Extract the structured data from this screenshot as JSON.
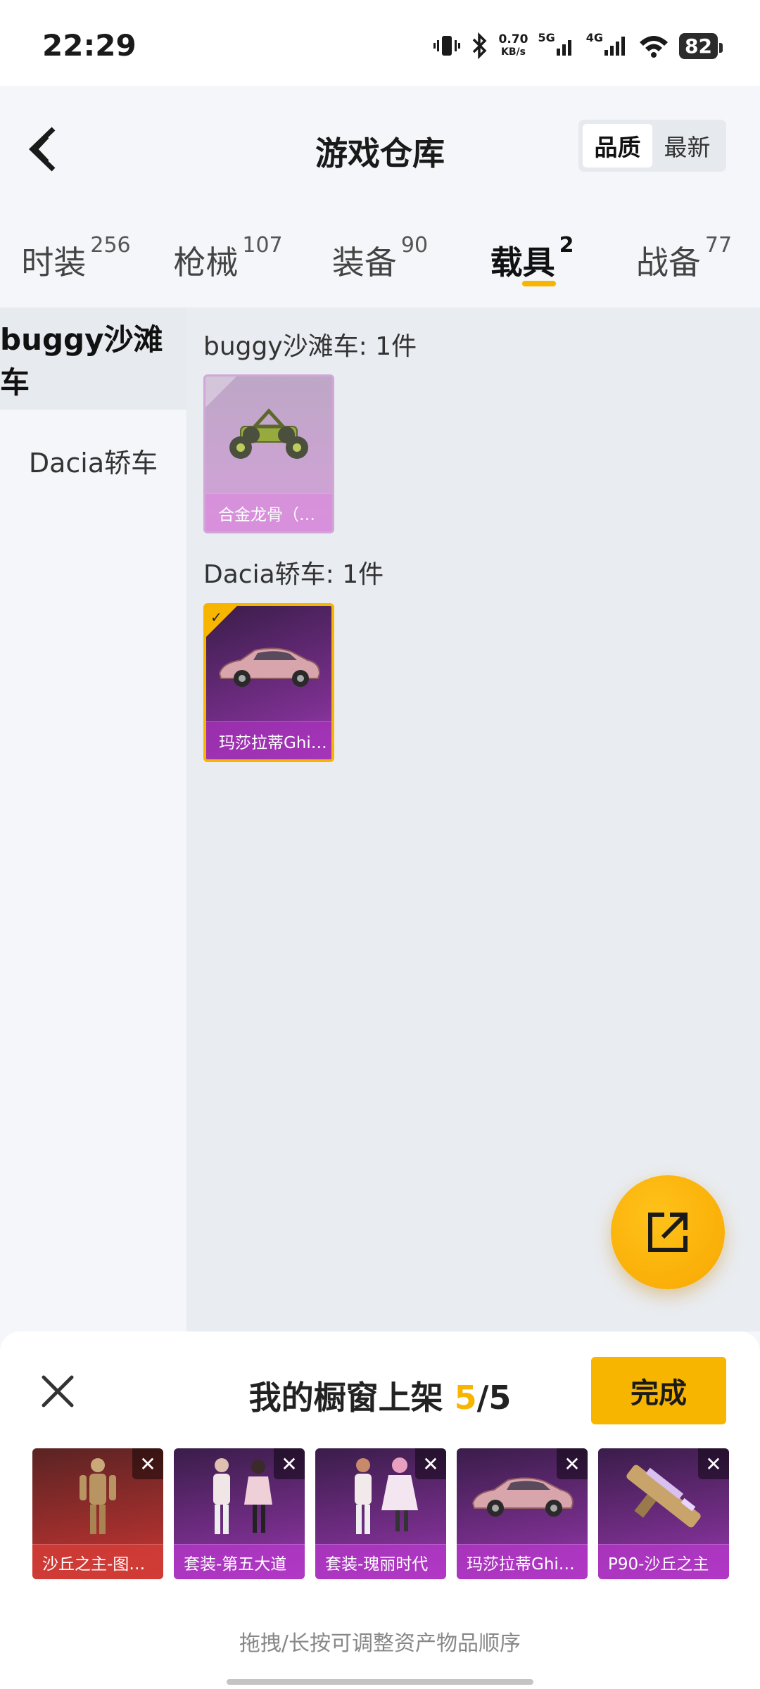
{
  "status_bar": {
    "time": "22:29",
    "speed_value": "0.70",
    "speed_unit": "KB/s",
    "net1": "5G",
    "net2": "4G",
    "battery": "82"
  },
  "header": {
    "title": "游戏仓库",
    "sort_options": [
      "品质",
      "最新"
    ],
    "sort_active": "品质"
  },
  "tabs": [
    {
      "label": "时装",
      "count": "256"
    },
    {
      "label": "枪械",
      "count": "107"
    },
    {
      "label": "装备",
      "count": "90"
    },
    {
      "label": "载具",
      "count": "2"
    },
    {
      "label": "战备",
      "count": "77"
    }
  ],
  "active_tab": "载具",
  "sidebar": {
    "items": [
      {
        "label": "buggy沙滩车"
      },
      {
        "label": "Dacia轿车"
      }
    ]
  },
  "groups": [
    {
      "title": "buggy沙滩车: 1件",
      "items": [
        {
          "name": "合金龙骨（…",
          "selected": false
        }
      ]
    },
    {
      "title": "Dacia轿车: 1件",
      "items": [
        {
          "name": "玛莎拉蒂Ghi…",
          "selected": true
        }
      ]
    }
  ],
  "fab": {
    "icon": "share-icon"
  },
  "showcase": {
    "title_prefix": "我的橱窗上架",
    "count_now": "5",
    "count_sep": "/",
    "count_max": "5",
    "done_label": "完成",
    "items": [
      {
        "name": "沙丘之主-图…",
        "color": "#c9302c"
      },
      {
        "name": "套装-第五大道",
        "color": "#a43dbd"
      },
      {
        "name": "套装-瑰丽时代",
        "color": "#a43dbd"
      },
      {
        "name": "玛莎拉蒂Ghi…",
        "color": "#a43dbd"
      },
      {
        "name": "P90-沙丘之主",
        "color": "#a43dbd"
      }
    ],
    "hint": "拖拽/长按可调整资产物品顺序"
  },
  "colors": {
    "accent": "#f7b500",
    "background": "#e9ecf0"
  }
}
